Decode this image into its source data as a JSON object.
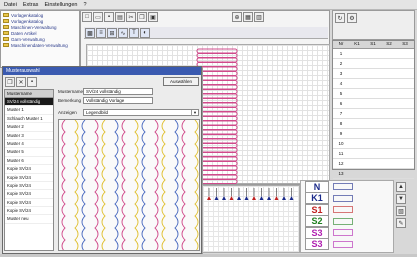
{
  "menu": [
    "Datei",
    "Extras",
    "Einstellungen",
    "?"
  ],
  "tree": {
    "items": [
      "Vorlagenkatalog",
      "Vorlagenkatalog",
      "Maschinen-Verwaltung",
      "Daten Artikel",
      "Garn-Verwaltung",
      "Maschinendaten-Verwaltung"
    ]
  },
  "toolbar": {
    "icons": [
      "new-icon",
      "open-icon",
      "save-icon",
      "print-icon",
      "cut-icon",
      "copy-icon",
      "paste-icon"
    ]
  },
  "dialog": {
    "title": "Musterauswahl",
    "apply_label": "Auswählen",
    "list_header": "Mustername",
    "list": [
      "SV/24 vollständig",
      "Muster 1",
      "Schlauch Muster 1",
      "Muster 2",
      "Muster 3",
      "Muster 4",
      "Muster 5",
      "Muster 6",
      "Kopie SV/24",
      "Kopie SV/24",
      "Kopie SV/24",
      "Kopie SV/24",
      "Kopie SV/24",
      "Kopie SV/24",
      "Muster neu"
    ],
    "selected_index": 0,
    "name_label": "Mustername",
    "name_value": "SV/24 vollständig",
    "remark_label": "Bemerkung",
    "remark_value": "Vollständig Vorlage",
    "view_label": "Anzeigen",
    "view_value": "Legendbild"
  },
  "table": {
    "headers": [
      "Nr",
      "K1",
      "S1",
      "S2",
      "S3"
    ],
    "rows": [
      [
        "1",
        "",
        "",
        "",
        ""
      ],
      [
        "2",
        "",
        "",
        "",
        ""
      ],
      [
        "3",
        "",
        "",
        "",
        ""
      ],
      [
        "4",
        "",
        "",
        "",
        ""
      ],
      [
        "5",
        "",
        "",
        "",
        ""
      ],
      [
        "6",
        "",
        "",
        "",
        ""
      ],
      [
        "7",
        "",
        "",
        "",
        ""
      ],
      [
        "8",
        "",
        "",
        "",
        ""
      ],
      [
        "9",
        "",
        "",
        "",
        ""
      ],
      [
        "10",
        "",
        "",
        "",
        ""
      ],
      [
        "11",
        "",
        "",
        "",
        ""
      ],
      [
        "12",
        "",
        "",
        "",
        ""
      ],
      [
        "13",
        "",
        "",
        "",
        ""
      ]
    ]
  },
  "legend": {
    "items": [
      {
        "label": "N",
        "color": "#1a2a8a"
      },
      {
        "label": "K1",
        "color": "#1a2a8a"
      },
      {
        "label": "S1",
        "color": "#c02020"
      },
      {
        "label": "S2",
        "color": "#208020"
      },
      {
        "label": "S3",
        "color": "#b020b0"
      },
      {
        "label": "S3",
        "color": "#b020b0"
      }
    ]
  },
  "colors": {
    "accent": "#3a5ab0",
    "yarn_pink": "#d04a8a",
    "yarn_yellow": "#e0c030",
    "yarn_blue": "#4a6ac0"
  }
}
